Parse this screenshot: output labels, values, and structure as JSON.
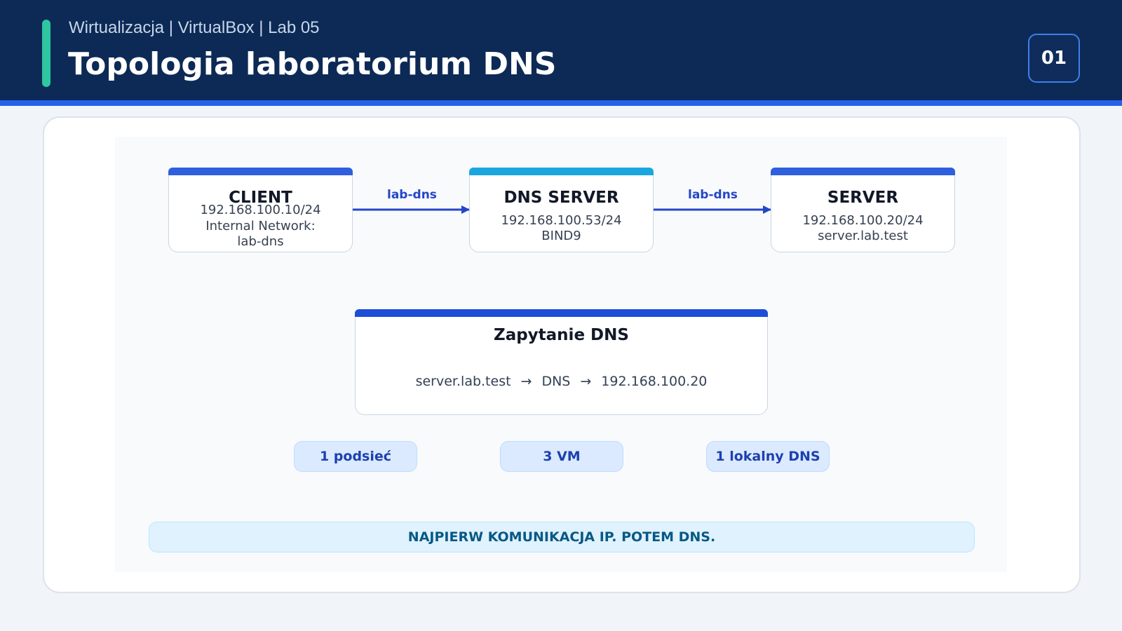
{
  "header": {
    "subtitle": "Wirtualizacja | VirtualBox | Lab 05",
    "title": "Topologia laboratorium DNS",
    "page_number": "01"
  },
  "nodes": [
    {
      "title": "CLIENT",
      "lines": [
        "192.168.100.10/24",
        "Internal Network:",
        "lab-dns"
      ],
      "accent": "#2f5fde"
    },
    {
      "title": "DNS SERVER",
      "lines": [
        "192.168.100.53/24",
        "BIND9"
      ],
      "accent": "#1aa7e0"
    },
    {
      "title": "SERVER",
      "lines": [
        "192.168.100.20/24",
        "server.lab.test"
      ],
      "accent": "#2f5fde"
    }
  ],
  "edges": [
    {
      "label": "lab-dns"
    },
    {
      "label": "lab-dns"
    }
  ],
  "query": {
    "title": "Zapytanie DNS",
    "from": "server.lab.test",
    "via": "DNS",
    "to": "192.168.100.20",
    "arrow": "→"
  },
  "stats": [
    "1 podsieć",
    "3 VM",
    "1 lokalny DNS"
  ],
  "note": "NAJPIERW KOMUNIKACJA IP. POTEM DNS.",
  "colors": {
    "header_bg": "#0d2a56",
    "accent_teal": "#2fc7a0",
    "primary_blue": "#2563eb",
    "edge_blue": "#2446c8",
    "dns_accent": "#1aa7e0"
  }
}
